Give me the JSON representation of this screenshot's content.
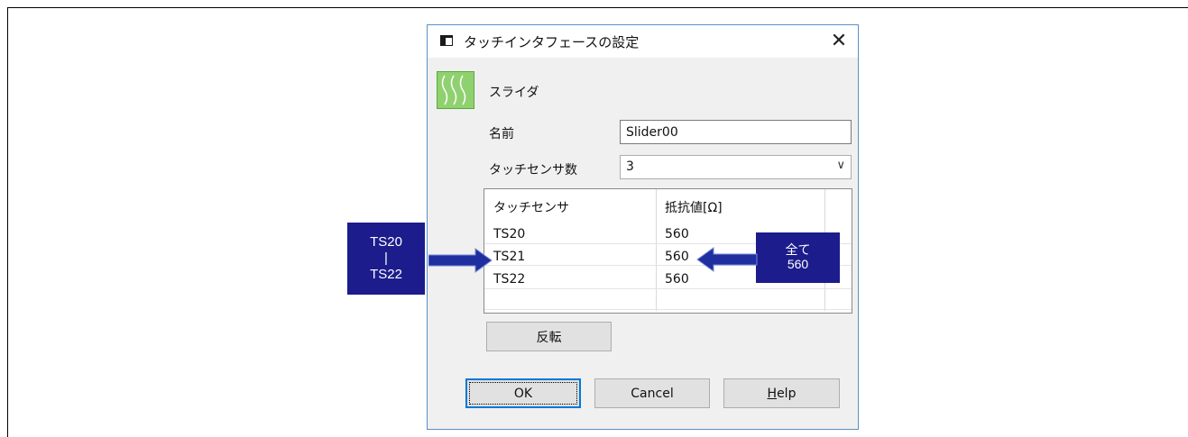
{
  "dialog": {
    "title": "タッチインタフェースの設定",
    "close_glyph": "✕",
    "type_label": "スライダ",
    "name_label": "名前",
    "name_value": "Slider00",
    "count_label": "タッチセンサ数",
    "count_value": "3",
    "count_chevron": "∨",
    "grid": {
      "columns": [
        "タッチセンサ",
        "抵抗値[Ω]"
      ],
      "rows": [
        {
          "sensor": "TS20",
          "resistance": "560"
        },
        {
          "sensor": "TS21",
          "resistance": "560"
        },
        {
          "sensor": "TS22",
          "resistance": "560"
        }
      ]
    },
    "reverse_label": "反転",
    "ok_label": "OK",
    "cancel_label": "Cancel",
    "help_label": "Help",
    "help_mnemonic": "H",
    "help_rest": "elp"
  },
  "annotations": {
    "left_line1": "TS20",
    "left_line2": "|",
    "left_line3": "TS22",
    "right_line1": "全て",
    "right_line2": "560",
    "arrow_color": "#1f2fa0",
    "callout_color": "#1c1c8c"
  },
  "icons": {
    "app": "window-icon",
    "slider": "slider-wave-icon",
    "close": "close-icon"
  }
}
